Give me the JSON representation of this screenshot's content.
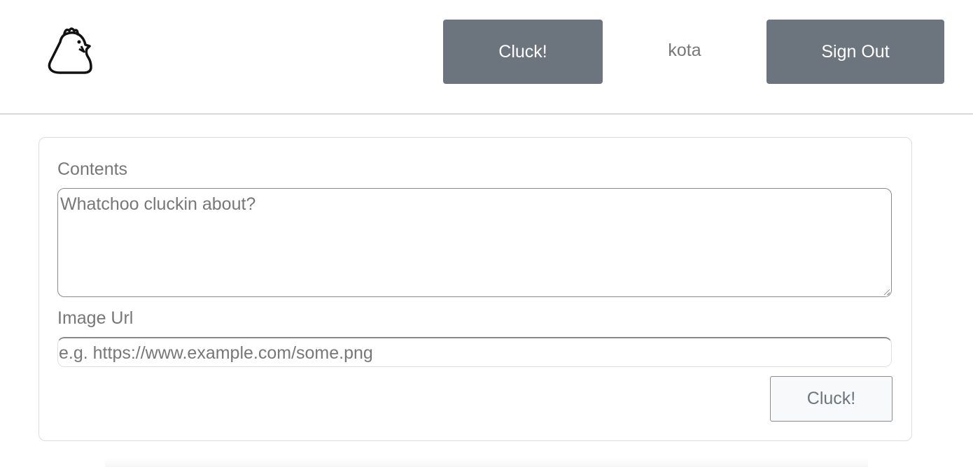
{
  "colors": {
    "primary_button": "#6c757d",
    "text_muted": "#777777",
    "light_button": "#f8f9fa"
  },
  "header": {
    "logo_icon": "chicken-icon",
    "cluck_label": "Cluck!",
    "username": "kota",
    "signout_label": "Sign Out"
  },
  "form": {
    "contents_label": "Contents",
    "contents_placeholder": "Whatchoo cluckin about?",
    "contents_value": "",
    "image_label": "Image Url",
    "image_placeholder": "e.g. https://www.example.com/some.png",
    "image_value": "",
    "submit_label": "Cluck!"
  }
}
